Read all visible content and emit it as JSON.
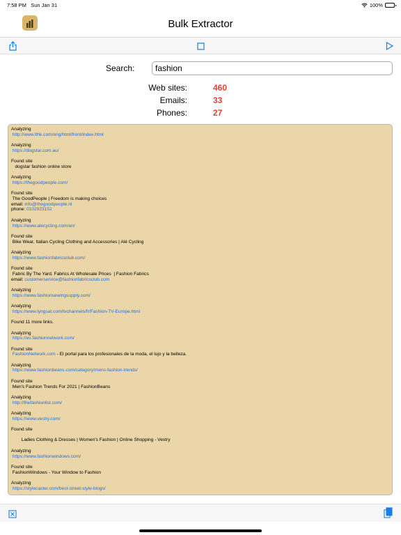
{
  "status": {
    "time": "7:58 PM",
    "date": "Sun Jan 31",
    "battery": "100%",
    "battery_level": 1.0
  },
  "nav": {
    "title": "Bulk Extractor"
  },
  "toolbar": {
    "icons": [
      "share-icon",
      "stop-icon",
      "play-icon"
    ]
  },
  "search": {
    "label": "Search:",
    "value": "fashion"
  },
  "stats": {
    "websites_label": "Web sites:",
    "websites": "460",
    "emails_label": "Emails:",
    "emails": "33",
    "phones_label": "Phones:",
    "phones": "27"
  },
  "log": [
    {
      "lines": [
        {
          "t": "Analyzing"
        },
        {
          "t": " http://www.lthk.com/eng/html/front/index.html",
          "link": true
        }
      ]
    },
    {
      "lines": [
        {
          "t": "Analyzing"
        },
        {
          "t": " https://dogstar.com.au/",
          "link": true
        }
      ]
    },
    {
      "lines": [
        {
          "t": "Found site"
        },
        {
          "t": "   dogstar fashion online store"
        }
      ]
    },
    {
      "lines": [
        {
          "t": "Analyzing"
        },
        {
          "t": " https://thegoodpeople.com/",
          "link": true
        }
      ]
    },
    {
      "lines": [
        {
          "t": "Found site"
        },
        {
          "t": " The GoodPeople | Freedom is making choices"
        },
        {
          "t": "email: ",
          "rest": "info@thegoodpeople.nl"
        },
        {
          "t": "phone: ",
          "rest": "0102923152"
        }
      ]
    },
    {
      "lines": [
        {
          "t": "Analyzing"
        },
        {
          "t": " https://www.alecycling.com/en/",
          "link": true
        }
      ]
    },
    {
      "lines": [
        {
          "t": "Found site"
        },
        {
          "t": " Bike Wear, Italian Cycling Clothing and Accessories | Alé Cycling"
        }
      ]
    },
    {
      "lines": [
        {
          "t": "Analyzing"
        },
        {
          "t": " https://www.fashionfabricsclub.com/",
          "link": true
        }
      ]
    },
    {
      "lines": [
        {
          "t": "Found site"
        },
        {
          "t": " Fabric By The Yard. Fabrics At Wholesale Prices  | Fashion Fabrics"
        },
        {
          "t": "email: ",
          "rest": "customerservice@fashionfabricsclub.com"
        }
      ]
    },
    {
      "lines": [
        {
          "t": "Analyzing"
        },
        {
          "t": " https://www.fashionsewingsupply.com/",
          "link": true
        }
      ]
    },
    {
      "lines": [
        {
          "t": "Analyzing"
        },
        {
          "t": " https://www.lyngsat.com/tvchannels/fr/Fashion-TV-Europe.html",
          "link": true
        }
      ]
    },
    {
      "lines": [
        {
          "t": "Found 11 more links."
        }
      ]
    },
    {
      "lines": [
        {
          "t": "Analyzing"
        },
        {
          "t": " https://es.fashionnetwork.com/",
          "link": true
        }
      ]
    },
    {
      "lines": [
        {
          "t": "Found site"
        },
        {
          "t": " FashionNetwork.com",
          "link": true,
          "rest": " - El portal para los profesionales de la moda, el lujo y la belleza."
        }
      ]
    },
    {
      "lines": [
        {
          "t": "Analyzing"
        },
        {
          "t": " https://www.fashionbeans.com/category/mens-fashion-trends/",
          "link": true
        }
      ]
    },
    {
      "lines": [
        {
          "t": "Found site"
        },
        {
          "t": " Men's Fashion Trends For 2021 | FashionBeans"
        }
      ]
    },
    {
      "lines": [
        {
          "t": "Analyzing"
        },
        {
          "t": " http://thefashionlist.com/",
          "link": true
        }
      ]
    },
    {
      "lines": [
        {
          "t": "Analyzing"
        },
        {
          "t": " https://www.vestry.com/",
          "link": true
        }
      ]
    },
    {
      "lines": [
        {
          "t": "Found site"
        },
        {
          "t": "",
          "blank": true
        },
        {
          "t": "        Ladies Clothing & Dresses | Women's Fashion | Online Shopping - Vestry"
        }
      ]
    },
    {
      "lines": [
        {
          "t": "Analyzing"
        },
        {
          "t": " https://www.fashionwindows.com/",
          "link": true
        }
      ]
    },
    {
      "lines": [
        {
          "t": "Found site"
        },
        {
          "t": " FashionWindows - Your Window to Fashion"
        }
      ]
    },
    {
      "lines": [
        {
          "t": "Analyzing"
        },
        {
          "t": " https://stylecaster.com/best-street-style-blogs/",
          "link": true
        }
      ]
    }
  ],
  "colors": {
    "accent": "#1a7ee8",
    "count": "#e0423a",
    "log_bg": "#ead6a9",
    "link": "#2a6fc9",
    "app_icon": "#d8b56a"
  }
}
